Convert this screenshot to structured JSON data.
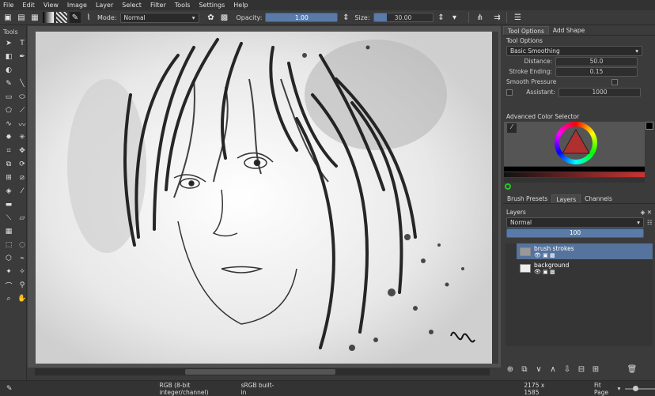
{
  "menu": [
    "File",
    "Edit",
    "View",
    "Image",
    "Layer",
    "Select",
    "Filter",
    "Tools",
    "Settings",
    "Help"
  ],
  "toolbar": {
    "mode_label": "Mode:",
    "mode_value": "Normal",
    "opacity_label": "Opacity:",
    "opacity_value": "1.00",
    "size_label": "Size:",
    "size_value": "30.00"
  },
  "tools": {
    "title": "Tools"
  },
  "tool_options": {
    "tabs": [
      "Tool Options",
      "Add Shape"
    ],
    "title": "Tool Options",
    "smoothing": "Basic Smoothing",
    "distance_label": "Distance:",
    "distance_value": "50.0",
    "stroke_ending_label": "Stroke Ending:",
    "stroke_ending_value": "0.15",
    "smooth_pressure_label": "Smooth Pressure",
    "assistant_label": "Assistant:",
    "assistant_value": "1000"
  },
  "color_selector": {
    "title": "Advanced Color Selector"
  },
  "layers_panel": {
    "tabs": [
      "Brush Presets",
      "Layers",
      "Channels"
    ],
    "title": "Layers",
    "blend_mode": "Normal",
    "opacity": "100",
    "layers": [
      {
        "name": "brush strokes",
        "selected": true
      },
      {
        "name": "background",
        "selected": false
      }
    ]
  },
  "status": {
    "color_space": "RGB (8-bit integer/channel)",
    "profile": "sRGB built-in",
    "dimensions": "2175 x 1585",
    "zoom": "Fit Page"
  },
  "colors": {
    "accent": "#5a7aa8",
    "bg": "#3b3b3b",
    "canvas": "#f4f4f4"
  }
}
